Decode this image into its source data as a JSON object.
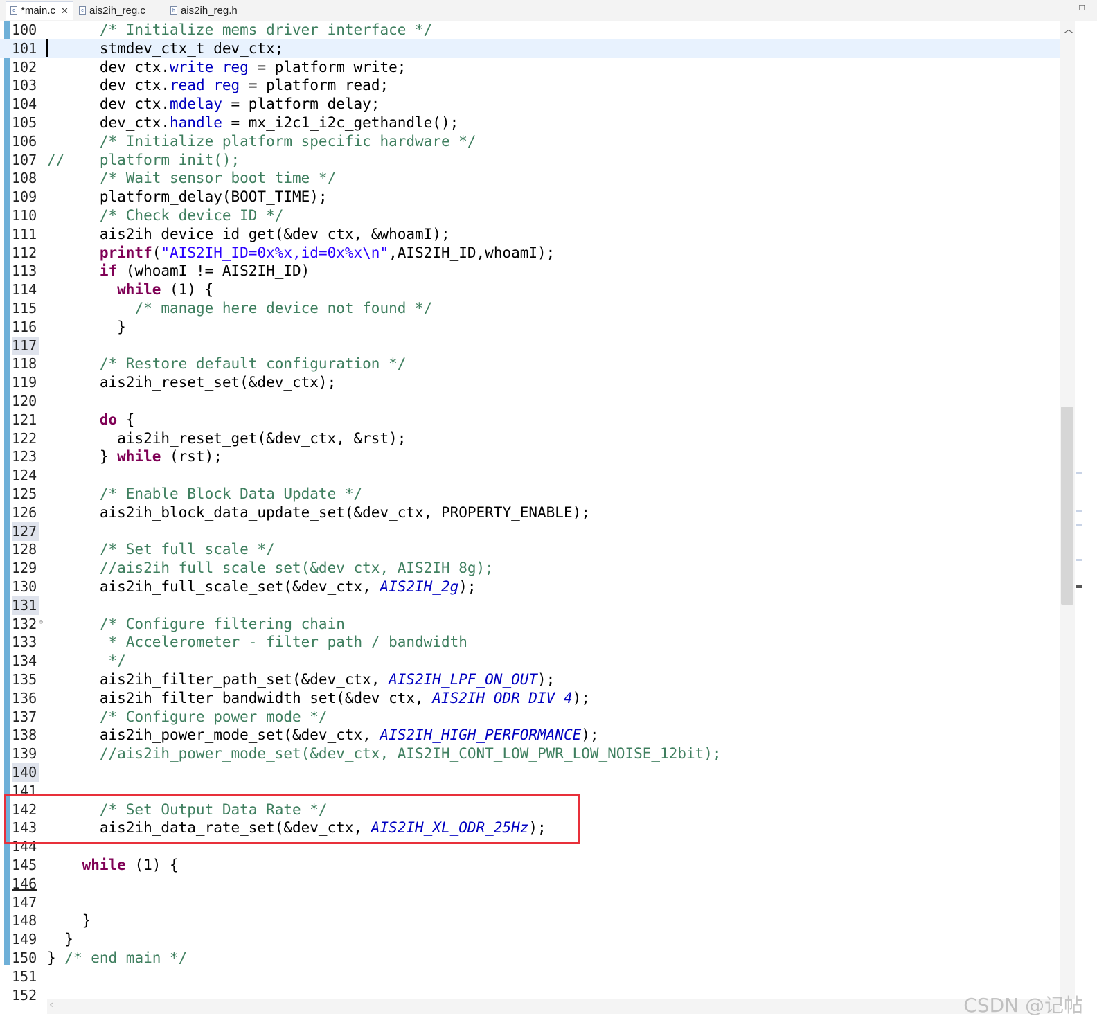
{
  "tabs": [
    {
      "label": "*main.c",
      "active": true,
      "closable": true
    },
    {
      "label": "ais2ih_reg.c",
      "active": false,
      "closable": false
    },
    {
      "label": "ais2ih_reg.h",
      "active": false,
      "closable": false
    }
  ],
  "window_controls": {
    "minimize": "–",
    "maximize": "□"
  },
  "colors": {
    "comment": "#3f7f5f",
    "keyword": "#7f0055",
    "field": "#0000c0",
    "string": "#2a00ff",
    "highlight_box": "#e8303a",
    "current_line": "#e8f2fe"
  },
  "code_lines": [
    {
      "n": "100",
      "indent": "      ",
      "tokens": [
        [
          "c",
          "/* Initialize mems driver interface */"
        ]
      ]
    },
    {
      "n": "101",
      "indent": "      ",
      "tokens": [
        [
          "p",
          "stmdev_ctx_t dev_ctx;"
        ]
      ],
      "current": true
    },
    {
      "n": "102",
      "indent": "      ",
      "tokens": [
        [
          "p",
          "dev_ctx."
        ],
        [
          "f",
          "write_reg"
        ],
        [
          "p",
          " = platform_write;"
        ]
      ]
    },
    {
      "n": "103",
      "indent": "      ",
      "tokens": [
        [
          "p",
          "dev_ctx."
        ],
        [
          "f",
          "read_reg"
        ],
        [
          "p",
          " = platform_read;"
        ]
      ]
    },
    {
      "n": "104",
      "indent": "      ",
      "tokens": [
        [
          "p",
          "dev_ctx."
        ],
        [
          "f",
          "mdelay"
        ],
        [
          "p",
          " = platform_delay;"
        ]
      ]
    },
    {
      "n": "105",
      "indent": "      ",
      "tokens": [
        [
          "p",
          "dev_ctx."
        ],
        [
          "f",
          "handle"
        ],
        [
          "p",
          " = mx_i2c1_i2c_gethandle();"
        ]
      ]
    },
    {
      "n": "106",
      "indent": "      ",
      "tokens": [
        [
          "c",
          "/* Initialize platform specific hardware */"
        ]
      ]
    },
    {
      "n": "107",
      "indent": "",
      "tokens": [
        [
          "c",
          "//    platform_init();"
        ]
      ]
    },
    {
      "n": "108",
      "indent": "      ",
      "tokens": [
        [
          "c",
          "/* Wait sensor boot time */"
        ]
      ]
    },
    {
      "n": "109",
      "indent": "      ",
      "tokens": [
        [
          "p",
          "platform_delay(BOOT_TIME);"
        ]
      ]
    },
    {
      "n": "110",
      "indent": "      ",
      "tokens": [
        [
          "c",
          "/* Check device ID */"
        ]
      ]
    },
    {
      "n": "111",
      "indent": "      ",
      "tokens": [
        [
          "p",
          "ais2ih_device_id_get(&dev_ctx, &whoamI);"
        ]
      ]
    },
    {
      "n": "112",
      "indent": "      ",
      "tokens": [
        [
          "k",
          "printf"
        ],
        [
          "p",
          "("
        ],
        [
          "s",
          "\"AIS2IH_ID=0x%x,id=0x%x\\n\""
        ],
        [
          "p",
          ",AIS2IH_ID,whoamI);"
        ]
      ]
    },
    {
      "n": "113",
      "indent": "      ",
      "tokens": [
        [
          "k",
          "if"
        ],
        [
          "p",
          " (whoamI != AIS2IH_ID)"
        ]
      ]
    },
    {
      "n": "114",
      "indent": "        ",
      "tokens": [
        [
          "k",
          "while"
        ],
        [
          "p",
          " (1) {"
        ]
      ]
    },
    {
      "n": "115",
      "indent": "          ",
      "tokens": [
        [
          "c",
          "/* manage here device not found */"
        ]
      ]
    },
    {
      "n": "116",
      "indent": "        ",
      "tokens": [
        [
          "p",
          "}"
        ]
      ]
    },
    {
      "n": "117",
      "indent": "",
      "tokens": [],
      "marked": true
    },
    {
      "n": "118",
      "indent": "      ",
      "tokens": [
        [
          "c",
          "/* Restore default configuration */"
        ]
      ]
    },
    {
      "n": "119",
      "indent": "      ",
      "tokens": [
        [
          "p",
          "ais2ih_reset_set(&dev_ctx);"
        ]
      ]
    },
    {
      "n": "120",
      "indent": "",
      "tokens": []
    },
    {
      "n": "121",
      "indent": "      ",
      "tokens": [
        [
          "k",
          "do"
        ],
        [
          "p",
          " {"
        ]
      ]
    },
    {
      "n": "122",
      "indent": "        ",
      "tokens": [
        [
          "p",
          "ais2ih_reset_get(&dev_ctx, &rst);"
        ]
      ]
    },
    {
      "n": "123",
      "indent": "      ",
      "tokens": [
        [
          "p",
          "} "
        ],
        [
          "k",
          "while"
        ],
        [
          "p",
          " (rst);"
        ]
      ]
    },
    {
      "n": "124",
      "indent": "",
      "tokens": []
    },
    {
      "n": "125",
      "indent": "      ",
      "tokens": [
        [
          "c",
          "/* Enable Block Data Update */"
        ]
      ]
    },
    {
      "n": "126",
      "indent": "      ",
      "tokens": [
        [
          "p",
          "ais2ih_block_data_update_set(&dev_ctx, PROPERTY_ENABLE);"
        ]
      ]
    },
    {
      "n": "127",
      "indent": "",
      "tokens": [],
      "marked": true
    },
    {
      "n": "128",
      "indent": "      ",
      "tokens": [
        [
          "c",
          "/* Set full scale */"
        ]
      ]
    },
    {
      "n": "129",
      "indent": "      ",
      "tokens": [
        [
          "c",
          "//ais2ih_full_scale_set(&dev_ctx, AIS2IH_8g);"
        ]
      ]
    },
    {
      "n": "130",
      "indent": "      ",
      "tokens": [
        [
          "p",
          "ais2ih_full_scale_set(&dev_ctx, "
        ],
        [
          "m",
          "AIS2IH_2g"
        ],
        [
          "p",
          ");"
        ]
      ]
    },
    {
      "n": "131",
      "indent": "",
      "tokens": [],
      "marked": true
    },
    {
      "n": "132",
      "indent": "      ",
      "tokens": [
        [
          "c",
          "/* Configure filtering chain"
        ]
      ],
      "fold": true
    },
    {
      "n": "133",
      "indent": "      ",
      "tokens": [
        [
          "c",
          " * Accelerometer - filter path / bandwidth"
        ]
      ]
    },
    {
      "n": "134",
      "indent": "      ",
      "tokens": [
        [
          "c",
          " */"
        ]
      ]
    },
    {
      "n": "135",
      "indent": "      ",
      "tokens": [
        [
          "p",
          "ais2ih_filter_path_set(&dev_ctx, "
        ],
        [
          "m",
          "AIS2IH_LPF_ON_OUT"
        ],
        [
          "p",
          ");"
        ]
      ]
    },
    {
      "n": "136",
      "indent": "      ",
      "tokens": [
        [
          "p",
          "ais2ih_filter_bandwidth_set(&dev_ctx, "
        ],
        [
          "m",
          "AIS2IH_ODR_DIV_4"
        ],
        [
          "p",
          ");"
        ]
      ]
    },
    {
      "n": "137",
      "indent": "      ",
      "tokens": [
        [
          "c",
          "/* Configure power mode */"
        ]
      ]
    },
    {
      "n": "138",
      "indent": "      ",
      "tokens": [
        [
          "p",
          "ais2ih_power_mode_set(&dev_ctx, "
        ],
        [
          "m",
          "AIS2IH_HIGH_PERFORMANCE"
        ],
        [
          "p",
          ");"
        ]
      ]
    },
    {
      "n": "139",
      "indent": "      ",
      "tokens": [
        [
          "c",
          "//ais2ih_power_mode_set(&dev_ctx, AIS2IH_CONT_LOW_PWR_LOW_NOISE_12bit);"
        ]
      ]
    },
    {
      "n": "140",
      "indent": "",
      "tokens": [],
      "marked": true
    },
    {
      "n": "141",
      "indent": "",
      "tokens": []
    },
    {
      "n": "142",
      "indent": "      ",
      "tokens": [
        [
          "c",
          "/* Set Output Data Rate */"
        ]
      ]
    },
    {
      "n": "143",
      "indent": "      ",
      "tokens": [
        [
          "p",
          "ais2ih_data_rate_set(&dev_ctx, "
        ],
        [
          "m",
          "AIS2IH_XL_ODR_25Hz"
        ],
        [
          "p",
          ");"
        ]
      ]
    },
    {
      "n": "144",
      "indent": "",
      "tokens": []
    },
    {
      "n": "145",
      "indent": "    ",
      "tokens": [
        [
          "k",
          "while"
        ],
        [
          "p",
          " (1) {"
        ]
      ]
    },
    {
      "n": "146",
      "indent": "",
      "tokens": [],
      "underline": true
    },
    {
      "n": "147",
      "indent": "",
      "tokens": []
    },
    {
      "n": "148",
      "indent": "    ",
      "tokens": [
        [
          "p",
          "}"
        ]
      ]
    },
    {
      "n": "149",
      "indent": "  ",
      "tokens": [
        [
          "p",
          "}"
        ]
      ]
    },
    {
      "n": "150",
      "indent": "",
      "tokens": [
        [
          "p",
          "} "
        ],
        [
          "c",
          "/* end main */"
        ]
      ]
    },
    {
      "n": "151",
      "indent": "",
      "tokens": []
    },
    {
      "n": "152",
      "indent": "",
      "tokens": []
    }
  ],
  "watermark": "CSDN @记帖"
}
